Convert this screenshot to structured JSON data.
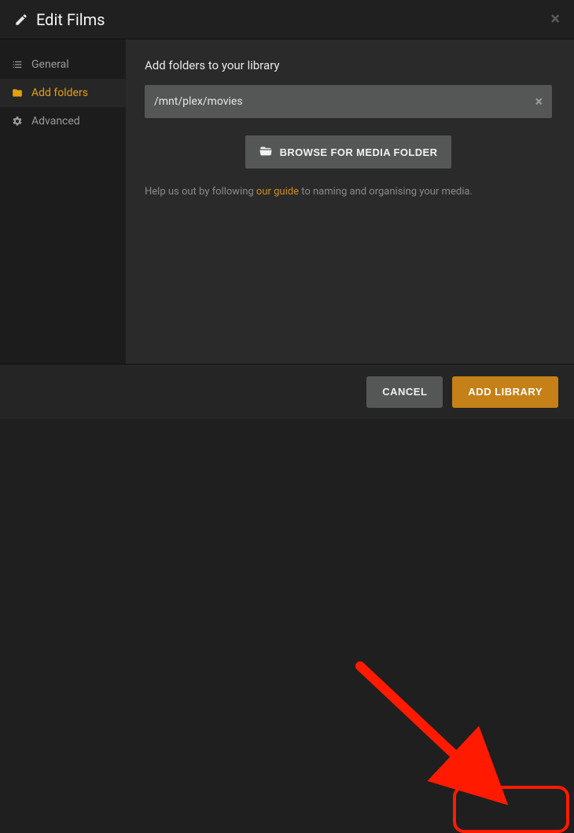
{
  "header": {
    "title": "Edit Films"
  },
  "sidebar": {
    "items": [
      {
        "label": "General",
        "icon": "list-icon"
      },
      {
        "label": "Add folders",
        "icon": "folder-icon"
      },
      {
        "label": "Advanced",
        "icon": "gear-icon"
      }
    ],
    "activeIndex": 1
  },
  "content": {
    "heading": "Add folders to your library",
    "folder_path": "/mnt/plex/movies",
    "browse_label": "BROWSE FOR MEDIA FOLDER",
    "help_prefix": "Help us out by following ",
    "help_link_text": "our guide",
    "help_suffix": " to naming and organising your media."
  },
  "footer": {
    "cancel_label": "CANCEL",
    "primary_label": "ADD LIBRARY"
  },
  "colors": {
    "accent": "#e5a00d",
    "primary_button": "#c58118",
    "annotation": "#ff1a00"
  }
}
